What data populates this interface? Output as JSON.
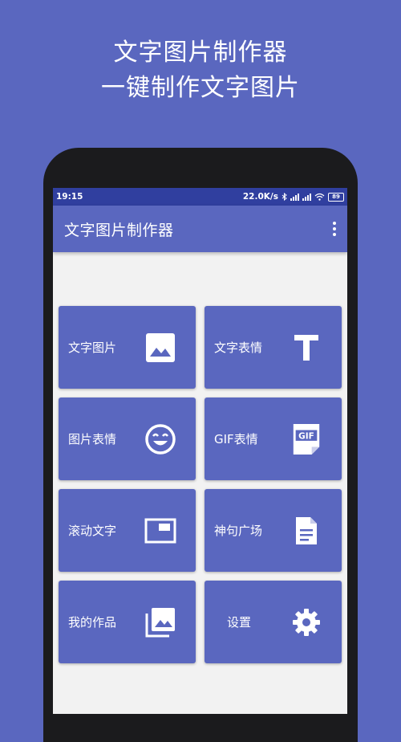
{
  "promo": {
    "line1": "文字图片制作器",
    "line2": "一键制作文字图片"
  },
  "statusbar": {
    "time": "19:15",
    "speed": "22.0K/s",
    "battery": "89"
  },
  "appbar": {
    "title": "文字图片制作器"
  },
  "tiles": [
    {
      "label": "文字图片",
      "icon": "image-icon"
    },
    {
      "label": "文字表情",
      "icon": "text-t-icon"
    },
    {
      "label": "图片表情",
      "icon": "smiley-icon"
    },
    {
      "label": "GIF表情",
      "icon": "gif-icon"
    },
    {
      "label": "滚动文字",
      "icon": "scroll-frame-icon"
    },
    {
      "label": "神句广场",
      "icon": "document-icon"
    },
    {
      "label": "我的作品",
      "icon": "gallery-stack-icon"
    },
    {
      "label": "设置",
      "icon": "gear-icon"
    }
  ],
  "colors": {
    "background": "#5a67bf",
    "statusbar": "#303f9f",
    "tile": "#5a67bf",
    "screen": "#f2f2f2"
  }
}
